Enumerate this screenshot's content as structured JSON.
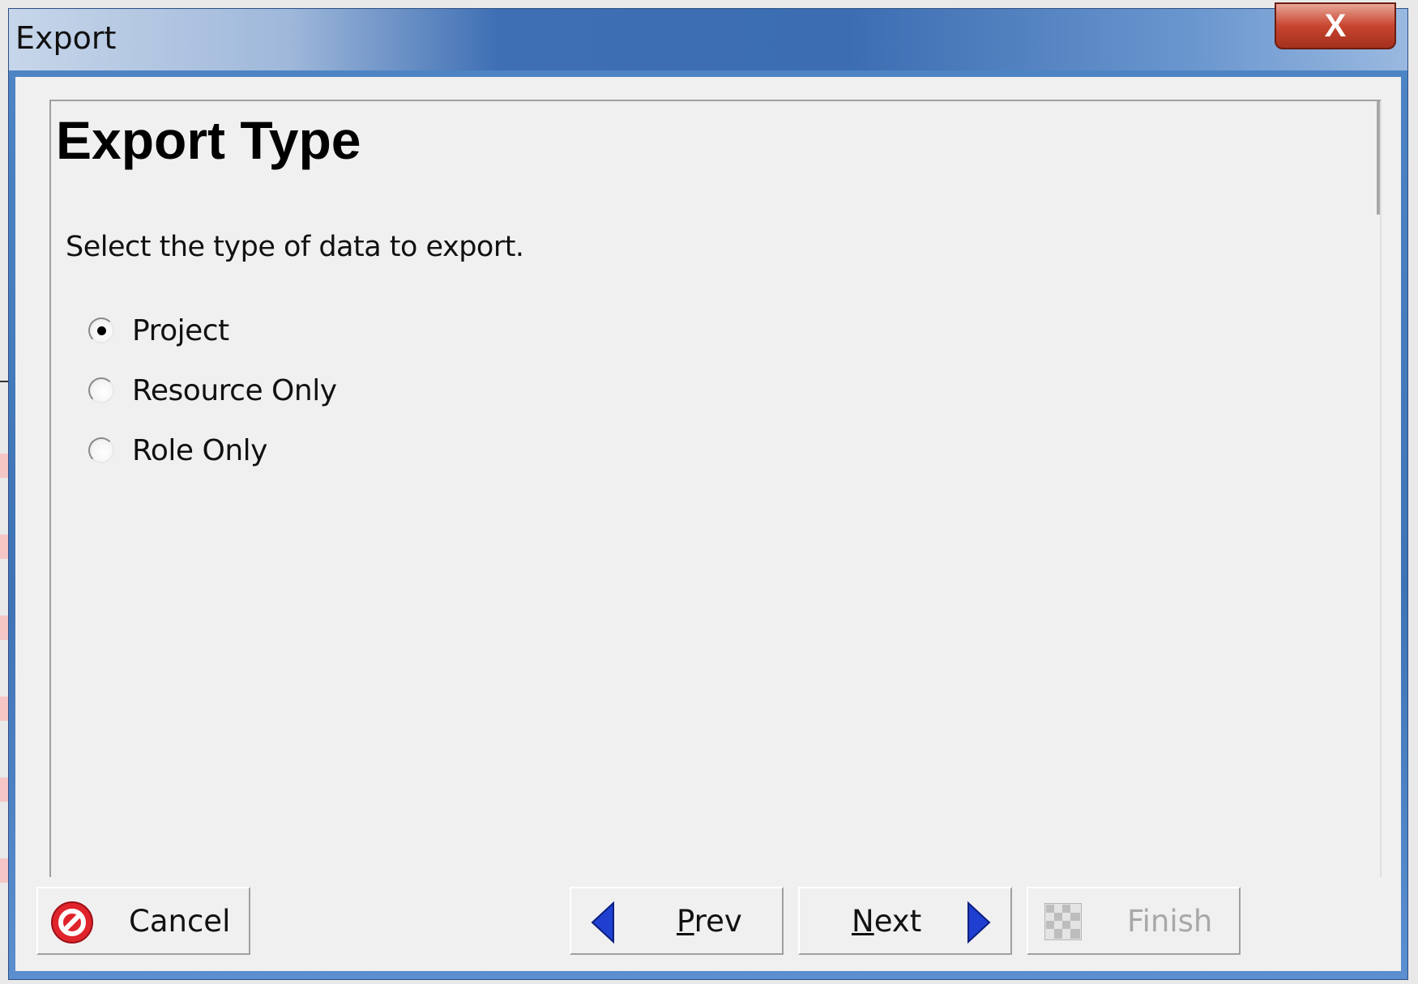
{
  "window": {
    "title": "Export",
    "close_glyph": "X"
  },
  "page": {
    "heading": "Export Type",
    "instruction": "Select the type of data to export."
  },
  "options": [
    {
      "label": "Project",
      "checked": true
    },
    {
      "label": "Resource Only",
      "checked": false
    },
    {
      "label": "Role Only",
      "checked": false
    }
  ],
  "buttons": {
    "cancel": {
      "label": "Cancel",
      "icon": "cancel-icon",
      "enabled": true
    },
    "prev": {
      "label_underlined": "P",
      "label_rest": "rev",
      "icon": "arrow-left-icon",
      "enabled": true
    },
    "next": {
      "label_underlined": "N",
      "label_rest": "ext",
      "icon": "arrow-right-icon",
      "enabled": true
    },
    "finish": {
      "label": "Finish",
      "icon": "checkered-flag-icon",
      "enabled": false
    }
  },
  "colors": {
    "title_bar": "#3e6fb4",
    "arrow_blue": "#1f3fd0",
    "cancel_red": "#e0242c"
  }
}
